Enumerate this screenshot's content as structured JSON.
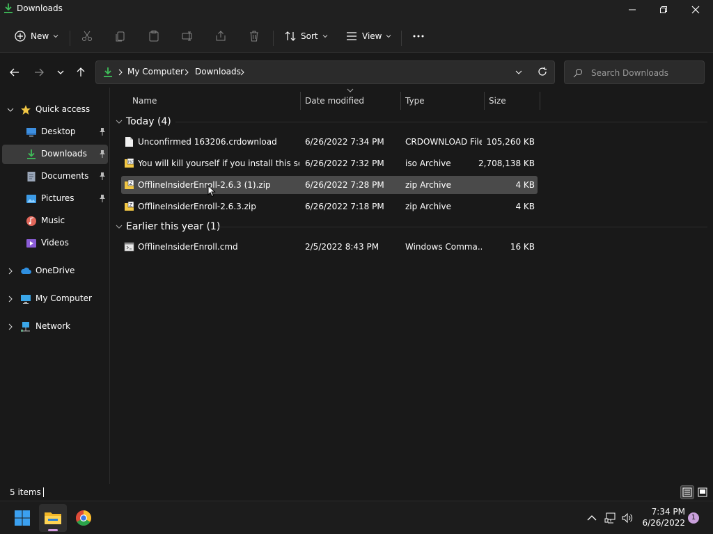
{
  "window": {
    "title": "Downloads"
  },
  "toolbar": {
    "new_label": "New",
    "sort_label": "Sort",
    "view_label": "View"
  },
  "address": {
    "crumbs": [
      "My Computer",
      "Downloads"
    ]
  },
  "search": {
    "placeholder": "Search Downloads"
  },
  "nav": {
    "items": [
      {
        "label": "Quick access",
        "icon": "star-icon"
      },
      {
        "label": "Desktop",
        "icon": "desktop-icon",
        "pinned": true
      },
      {
        "label": "Downloads",
        "icon": "download-icon",
        "pinned": true,
        "selected": true
      },
      {
        "label": "Documents",
        "icon": "documents-icon",
        "pinned": true
      },
      {
        "label": "Pictures",
        "icon": "pictures-icon",
        "pinned": true
      },
      {
        "label": "Music",
        "icon": "music-icon"
      },
      {
        "label": "Videos",
        "icon": "videos-icon"
      },
      {
        "label": "OneDrive",
        "icon": "cloud-icon"
      },
      {
        "label": "My Computer",
        "icon": "computer-icon"
      },
      {
        "label": "Network",
        "icon": "network-icon"
      }
    ]
  },
  "columns": {
    "name": "Name",
    "date": "Date modified",
    "type": "Type",
    "size": "Size"
  },
  "groups": [
    {
      "label": "Today (4)",
      "files": [
        {
          "name": "Unconfirmed 163206.crdownload",
          "date": "6/26/2022 7:34 PM",
          "type": "CRDOWNLOAD File",
          "size": "105,260 KB",
          "icon": "blank-file-icon"
        },
        {
          "name": "You will kill yourself if you install this so f...",
          "date": "6/26/2022 7:32 PM",
          "type": "iso Archive",
          "size": "2,708,138 KB",
          "icon": "iso-file-icon"
        },
        {
          "name": "OfflineInsiderEnroll-2.6.3 (1).zip",
          "date": "6/26/2022 7:28 PM",
          "type": "zip Archive",
          "size": "4 KB",
          "icon": "zip-file-icon",
          "selected": true
        },
        {
          "name": "OfflineInsiderEnroll-2.6.3.zip",
          "date": "6/26/2022 7:18 PM",
          "type": "zip Archive",
          "size": "4 KB",
          "icon": "zip-file-icon"
        }
      ]
    },
    {
      "label": "Earlier this year (1)",
      "files": [
        {
          "name": "OfflineInsiderEnroll.cmd",
          "date": "2/5/2022 8:43 PM",
          "type": "Windows Comma...",
          "size": "16 KB",
          "icon": "cmd-file-icon"
        }
      ]
    }
  ],
  "status": {
    "items": "5 items"
  },
  "taskbar": {
    "time": "7:34 PM",
    "date": "6/26/2022",
    "notifications": "1"
  },
  "colors": {
    "accent_green": "#3fbf5a",
    "folder_yellow": "#f2c744",
    "selected_row": "#4a4a4a",
    "notif": "#c9a0dc"
  }
}
